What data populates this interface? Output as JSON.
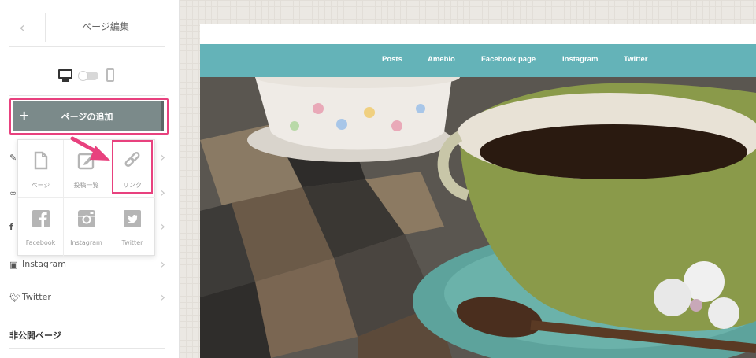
{
  "sidebar": {
    "back_icon": "chevron-left-icon",
    "title": "ページ編集",
    "device": {
      "desktop_icon": "desktop-icon",
      "mobile_icon": "mobile-icon"
    },
    "add_page_label": "ページの追加",
    "items": [
      {
        "icon": "edit-icon",
        "label": ""
      },
      {
        "icon": "link-icon",
        "label": ""
      },
      {
        "icon": "facebook-icon",
        "label": ""
      },
      {
        "icon": "instagram-icon",
        "label": "Instagram"
      },
      {
        "icon": "twitter-icon",
        "label": "Twitter"
      }
    ],
    "private_heading": "非公開ページ"
  },
  "popup": {
    "items": [
      {
        "label": "ページ",
        "icon": "page-icon"
      },
      {
        "label": "投稿一覧",
        "icon": "post-list-icon"
      },
      {
        "label": "リンク",
        "icon": "link-icon"
      },
      {
        "label": "Facebook",
        "icon": "facebook-icon"
      },
      {
        "label": "Instagram",
        "icon": "instagram-icon"
      },
      {
        "label": "Twitter",
        "icon": "twitter-icon"
      }
    ]
  },
  "site": {
    "nav": [
      "Posts",
      "Ameblo",
      "Facebook page",
      "Instagram",
      "Twitter"
    ]
  },
  "colors": {
    "accent": "#e8417e",
    "button": "#7b8a8a",
    "nav": "#64b3b8"
  }
}
